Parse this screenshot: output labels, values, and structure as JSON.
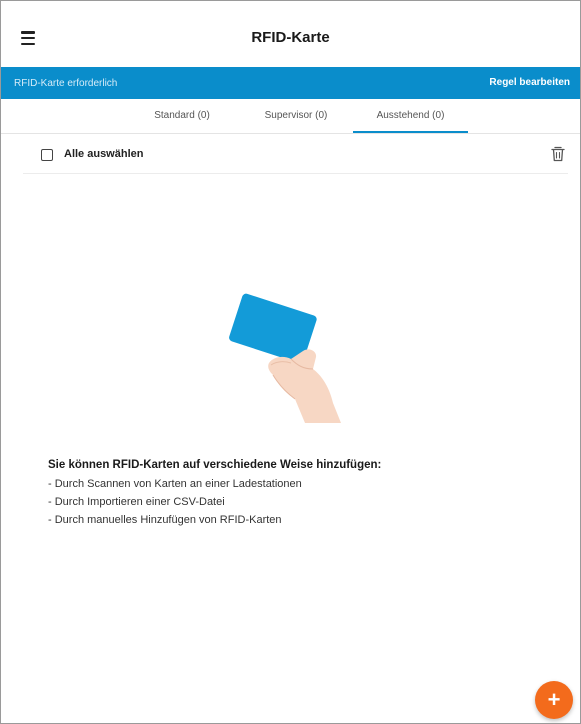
{
  "header": {
    "title": "RFID-Karte",
    "menu_icon": "hamburger-icon"
  },
  "banner": {
    "left_text": "RFID-Karte erforderlich",
    "right_action": "Regel bearbeiten",
    "color": "#0a8dcb"
  },
  "tabs": [
    {
      "label": "Standard (0)",
      "active": false
    },
    {
      "label": "Supervisor (0)",
      "active": false
    },
    {
      "label": "Ausstehend (0)",
      "active": true
    }
  ],
  "select_all": {
    "label": "Alle auswählen",
    "checked": false,
    "delete_icon": "trash-icon"
  },
  "empty_state": {
    "illustration_icon": "hand-holding-card-icon",
    "heading": "Sie können RFID-Karten auf verschiedene Weise hinzufügen:",
    "lines": [
      "- Durch Scannen von Karten an einer Ladestationen",
      "- Durch Importieren einer CSV-Datei",
      "- Durch manuelles Hinzufügen von RFID-Karten"
    ]
  },
  "fab": {
    "label": "+",
    "color": "#f36b1c"
  }
}
